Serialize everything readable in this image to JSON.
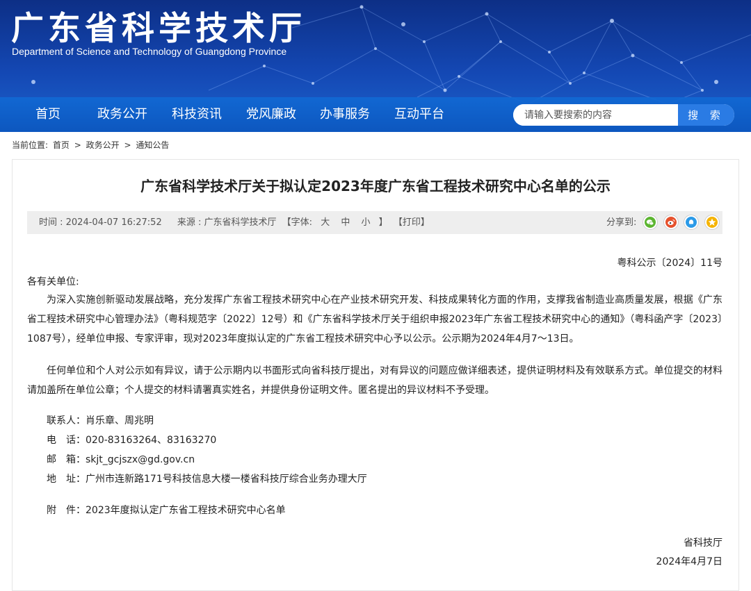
{
  "header": {
    "title_cn": "广东省科学技术厅",
    "title_en": "Department of Science and Technology of Guangdong Province"
  },
  "nav": {
    "items": [
      "首页",
      "政务公开",
      "科技资讯",
      "党风廉政",
      "办事服务",
      "互动平台"
    ]
  },
  "search": {
    "placeholder": "请输入要搜索的内容",
    "button_label": "搜 索"
  },
  "breadcrumb": {
    "prefix": "当前位置:",
    "items": [
      "首页",
      "政务公开",
      "通知公告"
    ],
    "separator": ">"
  },
  "article": {
    "title": "广东省科学技术厅关于拟认定2023年度广东省工程技术研究中心名单的公示",
    "meta": {
      "time": "时间 : 2024-04-07 16:27:52",
      "source": "来源 : 广东省科学技术厅",
      "font_label": "【字体:",
      "font_large": "大",
      "font_medium": "中",
      "font_small": "小",
      "font_close": "】",
      "print": "【打印】",
      "share_label": "分享到:"
    },
    "doc_no": "粤科公示〔2024〕11号",
    "salutation": "各有关单位:",
    "paragraphs": [
      "为深入实施创新驱动发展战略，充分发挥广东省工程技术研究中心在产业技术研究开发、科技成果转化方面的作用，支撑我省制造业高质量发展，根据《广东省工程技术研究中心管理办法》（粤科规范字〔2022〕12号）和《广东省科学技术厅关于组织申报2023年广东省工程技术研究中心的通知》（粤科函产字〔2023〕1087号），经单位申报、专家评审，现对2023年度拟认定的广东省工程技术研究中心予以公示。公示期为2024年4月7～13日。",
      "任何单位和个人对公示如有异议，请于公示期内以书面形式向省科技厅提出，对有异议的问题应做详细表述，提供证明材料及有效联系方式。单位提交的材料请加盖所在单位公章；个人提交的材料请署真实姓名，并提供身份证明文件。匿名提出的异议材料不予受理。"
    ],
    "contacts": {
      "person": "联系人：肖乐章、周兆明",
      "phone": "电　话：020-83163264、83163270",
      "email": "邮　箱：skjt_gcjszx@gd.gov.cn",
      "address": "地　址：广州市连新路171号科技信息大楼一楼省科技厅综合业务办理大厅"
    },
    "attachment": "附　件：2023年度拟认定广东省工程技术研究中心名单",
    "signature": "省科技厅",
    "date": "2024年4月7日"
  },
  "share_icons": [
    "wechat-icon",
    "weibo-icon",
    "qq-icon",
    "qzone-icon"
  ],
  "colors": {
    "banner_dark": "#0d2f86",
    "nav_blue": "#1169d4",
    "search_button": "#2a7be4",
    "wechat": "#5cb531",
    "weibo": "#e6512c",
    "qq": "#2b9ae8",
    "qzone": "#f5b300"
  }
}
